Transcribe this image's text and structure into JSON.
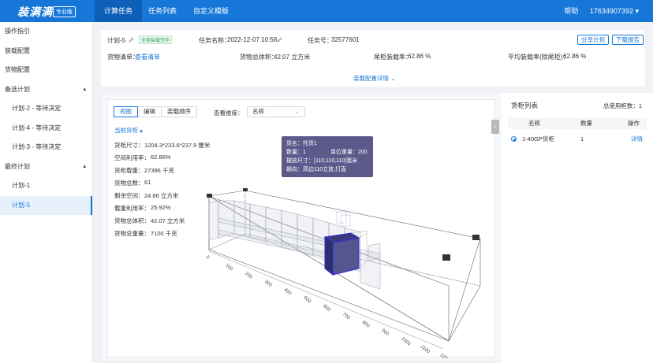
{
  "header": {
    "logo": "装满满",
    "edition": "专业版",
    "tabs": [
      "计算任务",
      "任务列表",
      "自定义模板"
    ],
    "help": "帮助",
    "user": "17634907392",
    "user_caret": "▾"
  },
  "sidebar": {
    "items": [
      {
        "label": "操作指引"
      },
      {
        "label": "装载配置"
      },
      {
        "label": "货物配置"
      },
      {
        "label": "备选计划",
        "caret": "▴"
      },
      {
        "label": "计划-2 - 等待决定"
      },
      {
        "label": "计划-4 - 等待决定"
      },
      {
        "label": "计划-3 - 等待决定"
      },
      {
        "label": "最终计划",
        "caret": "▴"
      },
      {
        "label": "计划-1"
      },
      {
        "label": "计划-5"
      }
    ]
  },
  "plan": {
    "name": "计划-5",
    "status_tag": "全部装载完毕",
    "task_name_label": "任务名称：",
    "task_name_value": "2022-12-07 10:58",
    "task_no_label": "任务号：",
    "task_no_value": "32577601",
    "share_button": "分享计划",
    "download_button": "下载报告",
    "cargo_list_label": "货物清单：",
    "cargo_list_link": "查看清单",
    "total_volume_label": "货物总体积：",
    "total_volume_value": "42.07 立方米",
    "tail_rate_label": "尾柜装载率：",
    "tail_rate_value": "62.86 %",
    "avg_rate_label": "平均装载率(除尾柜)：",
    "avg_rate_value": "62.86 %",
    "detail_link": "装载配置详情",
    "detail_caret": "⌄"
  },
  "view": {
    "modes": [
      "视图",
      "编辑",
      "装载顺序"
    ],
    "dimension_label": "查看维度：",
    "dimension_value": "名称",
    "dimension_chevron": "⌄",
    "current_container": "当前货柜",
    "current_caret": "▴",
    "stats": [
      {
        "label": "货柜尺寸：",
        "value": "1204.3*233.6*237.9 厘米"
      },
      {
        "label": "空间利用率：",
        "value": "62.86%"
      },
      {
        "label": "货柜载重：",
        "value": "27396 千克"
      },
      {
        "label": "货物总数：",
        "value": "61"
      },
      {
        "label": "剩余空间：",
        "value": "24.86 立方米"
      },
      {
        "label": "载重利用率：",
        "value": "25.92%"
      },
      {
        "label": "货物总体积：",
        "value": "42.07 立方米"
      },
      {
        "label": "货物总重量：",
        "value": "7100 千克"
      }
    ],
    "tooltip": {
      "name": "货名：托货1",
      "qty": "数量：1",
      "unit_weight": "单位重量：200",
      "size": "摆放尺寸：[110,110,110]厘米",
      "orientation": "朝向：高边110立放,打直"
    },
    "axis_ticks": [
      "0",
      "100",
      "200",
      "300",
      "400",
      "500",
      "600",
      "700",
      "800",
      "900",
      "1000",
      "1100",
      "1200"
    ]
  },
  "container_list": {
    "title": "货柜列表",
    "total_label": "总使用柜数：",
    "total_value": "1",
    "headers": [
      "名称",
      "数量",
      "操作"
    ],
    "rows": [
      {
        "name": "1-40GP货柜",
        "qty": "1",
        "action": "详情"
      }
    ]
  },
  "collapse_glyph": "›"
}
